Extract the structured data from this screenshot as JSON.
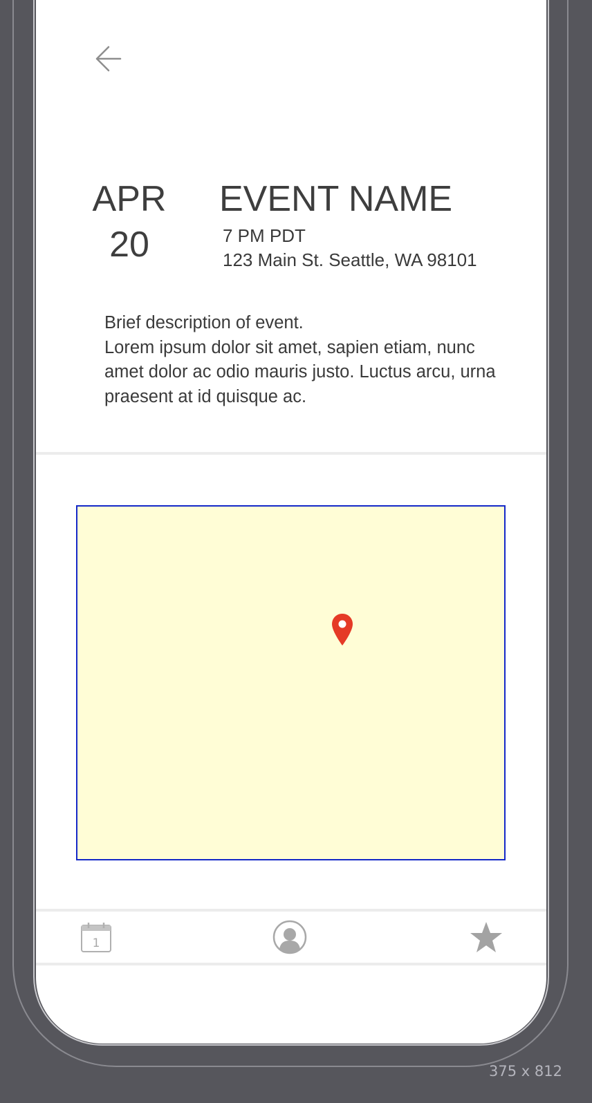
{
  "header": {
    "back_icon": "arrow-left-icon"
  },
  "event": {
    "month": "APR",
    "day": "20",
    "name": "EVENT NAME",
    "time": "7 PM PDT",
    "address": "123 Main St. Seattle, WA 98101",
    "description_title": "Brief description of event.",
    "description_body": "Lorem ipsum dolor sit amet, sapien etiam, nunc amet dolor ac odio mauris justo. Luctus arcu, urna praesent at id quisque ac."
  },
  "map": {
    "pin_icon": "map-pin-icon",
    "background_color": "#fffdd6",
    "border_color": "#1428c8",
    "pin_color": "#e53a26"
  },
  "tabbar": {
    "items": [
      {
        "icon": "calendar-icon",
        "badge_text": "1"
      },
      {
        "icon": "profile-icon"
      },
      {
        "icon": "star-icon"
      }
    ]
  },
  "footer": {
    "size_label": "375 x 812"
  }
}
